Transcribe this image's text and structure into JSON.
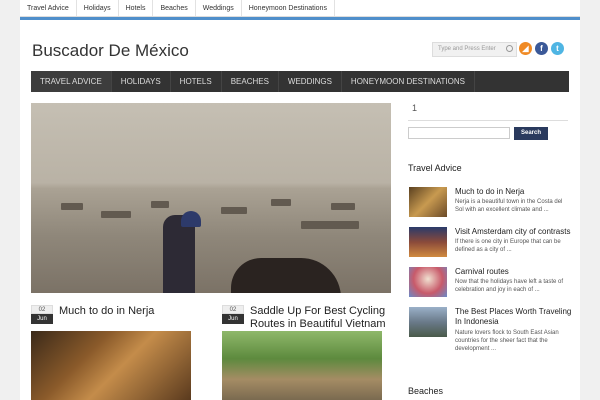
{
  "topbar": {
    "items": [
      "Travel Advice",
      "Holidays",
      "Hotels",
      "Beaches",
      "Weddings",
      "Honeymoon Destinations"
    ]
  },
  "header": {
    "site_title": "Buscador De México",
    "search_placeholder": "Type and Press Enter",
    "social": [
      {
        "name": "rss-icon",
        "glyph": "◢",
        "color": "#f08a24"
      },
      {
        "name": "facebook-icon",
        "glyph": "f",
        "color": "#3b5998"
      },
      {
        "name": "twitter-icon",
        "glyph": "t",
        "color": "#4fb5e3"
      }
    ]
  },
  "nav": {
    "items": [
      "TRAVEL ADVICE",
      "HOLIDAYS",
      "HOTELS",
      "BEACHES",
      "WEDDINGS",
      "HONEYMOON DESTINATIONS"
    ]
  },
  "posts": [
    {
      "day": "02",
      "month": "Jun",
      "title": "Much to do in Nerja"
    },
    {
      "day": "02",
      "month": "Jun",
      "title": "Saddle Up For Best Cycling Routes in Beautiful Vietnam"
    }
  ],
  "sidebar": {
    "label": "1",
    "search_button": "Search",
    "section_travel": "Travel Advice",
    "items": [
      {
        "title": "Much to do in Nerja",
        "excerpt": "Nerja is a beautiful town in the Costa del Sol with an excellent climate and ..."
      },
      {
        "title": "Visit Amsterdam city of contrasts",
        "excerpt": "If there is one city in Europe that can be defined as a city of ..."
      },
      {
        "title": "Carnival routes",
        "excerpt": "Now that the holidays have left a taste of celebration and joy in each of ..."
      },
      {
        "title": "The Best Places Worth Traveling In Indonesia",
        "excerpt": "Nature lovers flock to South East Asian countries for the sheer fact that the development ..."
      }
    ],
    "section_beaches": "Beaches"
  }
}
